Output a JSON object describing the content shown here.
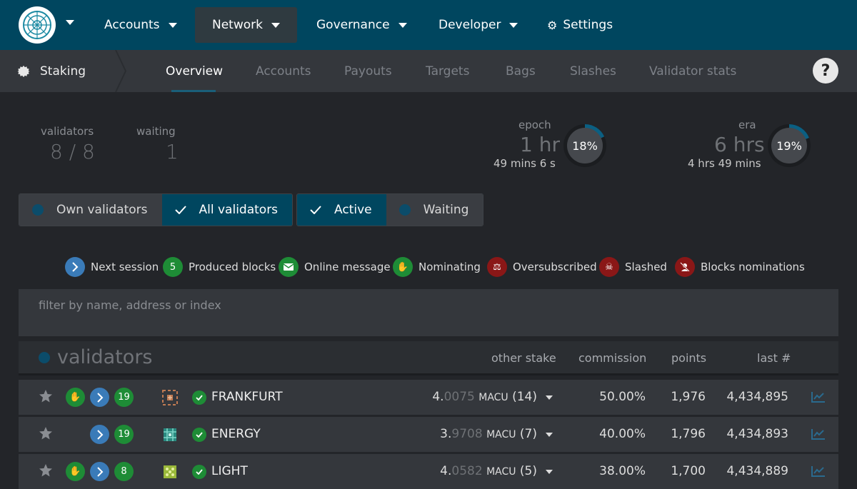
{
  "topnav": {
    "items": [
      {
        "label": "Accounts"
      },
      {
        "label": "Network"
      },
      {
        "label": "Governance"
      },
      {
        "label": "Developer"
      },
      {
        "label": "Settings"
      }
    ],
    "active": "Network"
  },
  "subnav": {
    "section": "Staking",
    "tabs": [
      "Overview",
      "Accounts",
      "Payouts",
      "Targets",
      "Bags",
      "Slashes",
      "Validator stats"
    ],
    "active": "Overview",
    "help": "?"
  },
  "summary": {
    "validators_label": "validators",
    "validators_value": "8 / 8",
    "waiting_label": "waiting",
    "waiting_value": "1",
    "epoch": {
      "label": "epoch",
      "big": "1 hr",
      "sub": "49 mins 6 s",
      "percent_label": "18%",
      "progress": 0.18
    },
    "era": {
      "label": "era",
      "big": "6 hrs",
      "sub": "4 hrs 49 mins",
      "percent_label": "19%",
      "progress": 0.19
    }
  },
  "toggles": {
    "own": "Own validators",
    "all": "All validators",
    "active": "Active",
    "waiting": "Waiting"
  },
  "legend": [
    {
      "icon": "chevron-right-icon",
      "badge": "",
      "label": "Next session",
      "color": "#3a7bb8"
    },
    {
      "icon": "number-badge",
      "badge": "5",
      "label": "Produced blocks",
      "color": "#1e8c36"
    },
    {
      "icon": "envelope-icon",
      "badge": "",
      "label": "Online message",
      "color": "#1e8c36"
    },
    {
      "icon": "hand-icon",
      "badge": "",
      "label": "Nominating",
      "color": "#1e8c36"
    },
    {
      "icon": "balance-scale-icon",
      "badge": "",
      "label": "Oversubscribed",
      "color": "#8a1717"
    },
    {
      "icon": "skull-crossbones-icon",
      "badge": "",
      "label": "Slashed",
      "color": "#8a1717"
    },
    {
      "icon": "user-slash-icon",
      "badge": "",
      "label": "Blocks nominations",
      "color": "#8a1717"
    }
  ],
  "filter": {
    "placeholder": "filter by name, address or index"
  },
  "table": {
    "title": "validators",
    "headers": {
      "other_stake": "other stake",
      "commission": "commission",
      "points": "points",
      "last": "last #"
    },
    "rows": [
      {
        "name": "FRANKFURT",
        "nominating": true,
        "blocks": "19",
        "stake_int": "4.",
        "stake_frac": "0075",
        "unit": "MACU",
        "count": "(14)",
        "commission": "50.00%",
        "points": "1,976",
        "last": "4,434,895"
      },
      {
        "name": "ENERGY",
        "nominating": false,
        "blocks": "19",
        "stake_int": "3.",
        "stake_frac": "9708",
        "unit": "MACU",
        "count": "(7)",
        "commission": "40.00%",
        "points": "1,796",
        "last": "4,434,893"
      },
      {
        "name": "LIGHT",
        "nominating": true,
        "blocks": "8",
        "stake_int": "4.",
        "stake_frac": "0582",
        "unit": "MACU",
        "count": "(5)",
        "commission": "38.00%",
        "points": "1,700",
        "last": "4,434,889"
      }
    ]
  },
  "colors": {
    "topbar": "#00465f",
    "accent": "#1e8c36",
    "danger": "#8a1717",
    "info": "#3a7bb8"
  }
}
